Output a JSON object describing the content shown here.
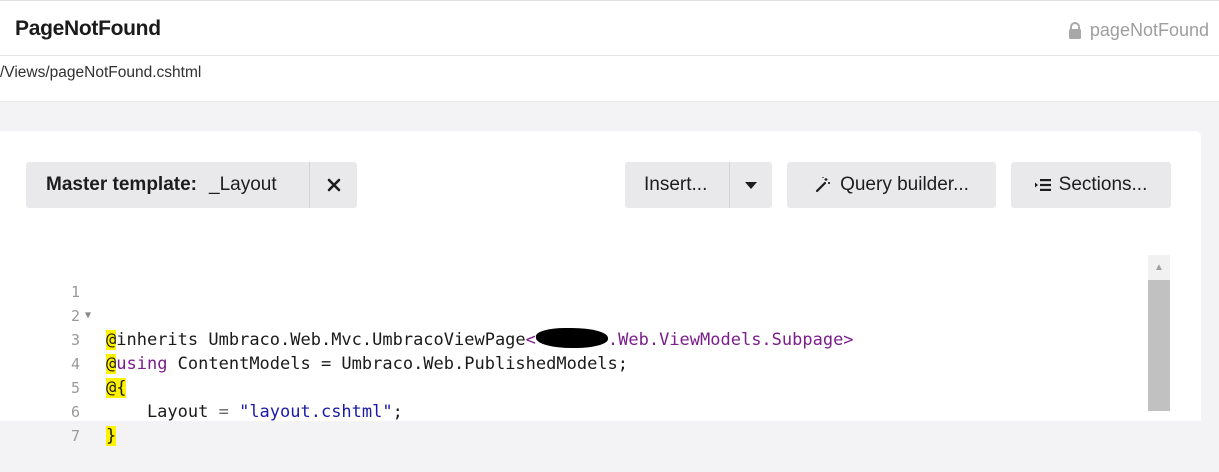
{
  "header": {
    "page_name": "PageNotFound",
    "alias": "pageNotFound"
  },
  "path": "/Views/pageNotFound.cshtml",
  "toolbar": {
    "master_label": "Master template:",
    "master_value": "_Layout",
    "insert_label": "Insert...",
    "query_label": "Query builder...",
    "sections_label": "Sections..."
  },
  "editor": {
    "line_numbers": [
      "1",
      "2",
      "3",
      "4",
      "5",
      "6",
      "7"
    ],
    "line1": {
      "at": "@",
      "keyword": "inherits",
      "rest": " Umbraco.Web.Mvc.UmbracoViewPage",
      "generic_open": "<",
      "generic_tail": ".Web.ViewModels.Subpage>"
    },
    "line3": {
      "at": "@",
      "keyword": "using",
      "rest": " ContentModels = Umbraco.Web.PublishedModels;"
    },
    "line4": {
      "at": "@{"
    },
    "line5": {
      "indent": "    Layout ",
      "eq": "=",
      "string": " \"layout.cshtml\"",
      "end": ";"
    },
    "line6": {
      "close": "}"
    }
  }
}
